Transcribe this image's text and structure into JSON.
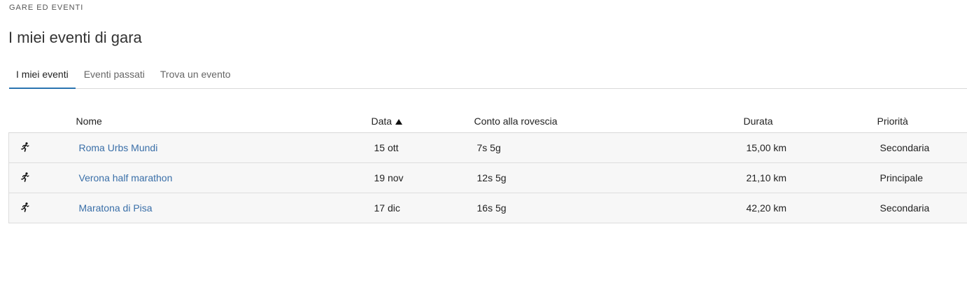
{
  "header": {
    "section_label": "GARE ED EVENTI",
    "title": "I miei eventi di gara"
  },
  "tabs": [
    {
      "label": "I miei eventi",
      "active": true
    },
    {
      "label": "Eventi passati",
      "active": false
    },
    {
      "label": "Trova un evento",
      "active": false
    }
  ],
  "table": {
    "columns": {
      "name": "Nome",
      "date": "Data",
      "countdown": "Conto alla rovescia",
      "distance": "Durata",
      "priority": "Priorità"
    },
    "sort": {
      "column": "date",
      "direction": "ascending"
    },
    "rows": [
      {
        "icon": "running-icon",
        "name": "Roma Urbs Mundi",
        "date": "15 ott",
        "countdown": "7s 5g",
        "distance": "15,00 km",
        "priority": "Secondaria"
      },
      {
        "icon": "running-icon",
        "name": "Verona half marathon",
        "date": "19 nov",
        "countdown": "12s 5g",
        "distance": "21,10 km",
        "priority": "Principale"
      },
      {
        "icon": "running-icon",
        "name": "Maratona di Pisa",
        "date": "17 dic",
        "countdown": "16s 5g",
        "distance": "42,20 km",
        "priority": "Secondaria"
      }
    ]
  },
  "colors": {
    "link": "#3a6fa8",
    "tab_active_underline": "#2a74b0",
    "row_background": "#f7f7f7"
  }
}
